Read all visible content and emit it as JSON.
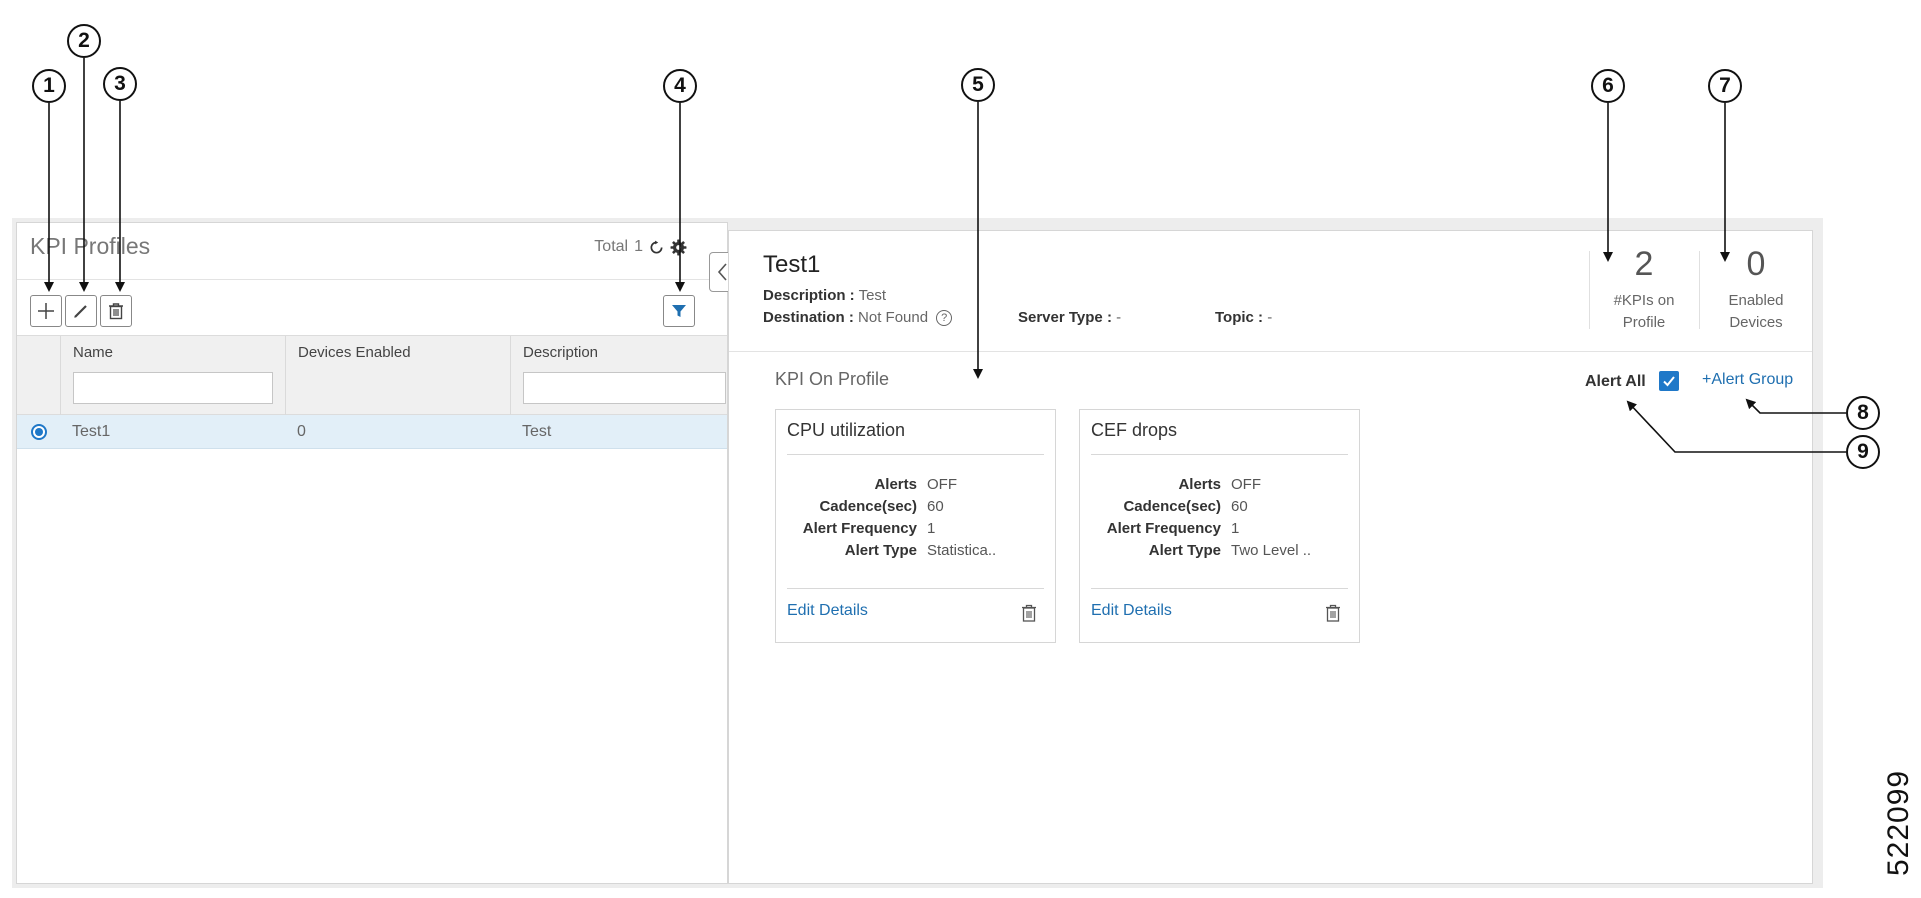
{
  "kpi_profiles": {
    "title": "KPI Profiles",
    "total_label": "Total",
    "total_value": "1",
    "toolbar_icons": [
      "plus-icon",
      "pencil-icon",
      "trash-icon",
      "filter-icon",
      "refresh-icon",
      "gear-icon"
    ],
    "columns": [
      "Name",
      "Devices Enabled",
      "Description"
    ],
    "rows": [
      {
        "name": "Test1",
        "devices_enabled": "0",
        "description": "Test",
        "selected": true
      }
    ]
  },
  "detail": {
    "title": "Test1",
    "description_label": "Description :",
    "description_value": "Test",
    "destination_label": "Destination :",
    "destination_value": "Not Found",
    "server_type_label": "Server Type :",
    "server_type_value": "-",
    "topic_label": "Topic :",
    "topic_value": "-",
    "stats": [
      {
        "value": "2",
        "label_line1": "#KPIs on",
        "label_line2": "Profile"
      },
      {
        "value": "0",
        "label_line1": "Enabled",
        "label_line2": "Devices"
      }
    ],
    "kpi_on_profile_title": "KPI On Profile",
    "alert_all_label": "Alert All",
    "alert_all_checked": true,
    "alert_group_label": "+Alert Group",
    "kpis": [
      {
        "title": "CPU utilization",
        "fields": [
          {
            "key": "Alerts",
            "value": "OFF"
          },
          {
            "key": "Cadence(sec)",
            "value": "60"
          },
          {
            "key": "Alert Frequency",
            "value": "1"
          },
          {
            "key": "Alert Type",
            "value": "Statistica.."
          }
        ],
        "edit_label": "Edit Details"
      },
      {
        "title": "CEF drops",
        "fields": [
          {
            "key": "Alerts",
            "value": "OFF"
          },
          {
            "key": "Cadence(sec)",
            "value": "60"
          },
          {
            "key": "Alert Frequency",
            "value": "1"
          },
          {
            "key": "Alert Type",
            "value": "Two Level .."
          }
        ],
        "edit_label": "Edit Details"
      }
    ]
  },
  "callouts": [
    "1",
    "2",
    "3",
    "4",
    "5",
    "6",
    "7",
    "8",
    "9"
  ],
  "figure_id": "522099",
  "colors": {
    "accent": "#1f78c8",
    "link": "#1f6fb0",
    "selected_row": "#e2eff8"
  }
}
